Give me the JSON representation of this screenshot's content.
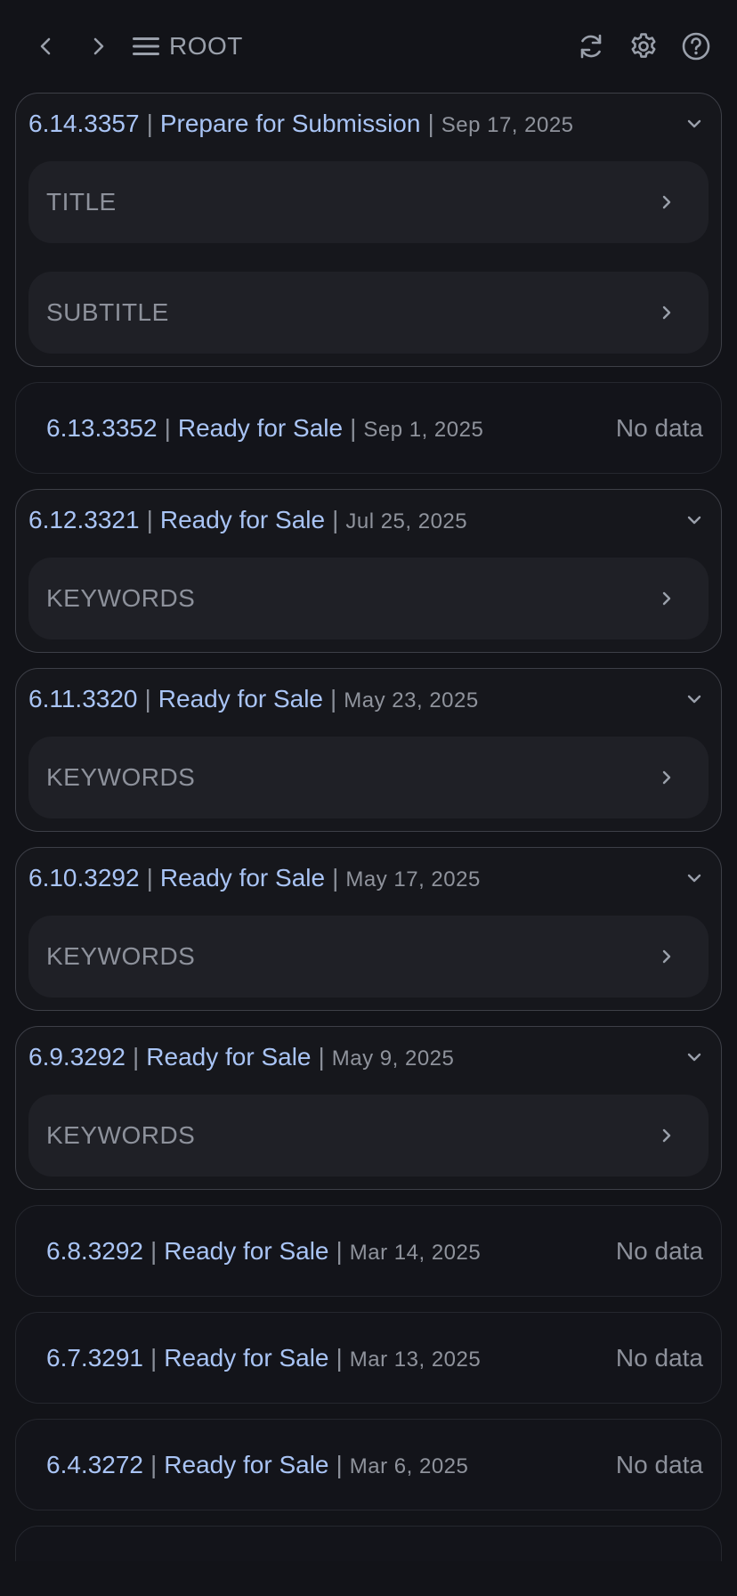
{
  "topbar": {
    "root_label": "ROOT",
    "icons": [
      "chevron-left-icon",
      "chevron-right-icon",
      "menu-icon",
      "refresh-icon",
      "gear-icon",
      "help-icon"
    ]
  },
  "colors": {
    "background": "#121318",
    "accent_text": "#a9c4f5",
    "muted_text": "#8d919b",
    "card_border": "#3d3f47",
    "field_bg": "#1f2026"
  },
  "separator": "|",
  "versions": [
    {
      "version": "6.14.3357",
      "status": "Prepare for Submission",
      "date": "Sep 17, 2025",
      "expanded": true,
      "fields": [
        "TITLE",
        "SUBTITLE"
      ]
    },
    {
      "version": "6.13.3352",
      "status": "Ready for Sale",
      "date": "Sep 1, 2025",
      "expanded": false,
      "no_data": "No data"
    },
    {
      "version": "6.12.3321",
      "status": "Ready for Sale",
      "date": "Jul 25, 2025",
      "expanded": true,
      "fields": [
        "KEYWORDS"
      ]
    },
    {
      "version": "6.11.3320",
      "status": "Ready for Sale",
      "date": "May 23, 2025",
      "expanded": true,
      "fields": [
        "KEYWORDS"
      ]
    },
    {
      "version": "6.10.3292",
      "status": "Ready for Sale",
      "date": "May 17, 2025",
      "expanded": true,
      "fields": [
        "KEYWORDS"
      ]
    },
    {
      "version": "6.9.3292",
      "status": "Ready for Sale",
      "date": "May 9, 2025",
      "expanded": true,
      "fields": [
        "KEYWORDS"
      ]
    },
    {
      "version": "6.8.3292",
      "status": "Ready for Sale",
      "date": "Mar 14, 2025",
      "expanded": false,
      "no_data": "No data"
    },
    {
      "version": "6.7.3291",
      "status": "Ready for Sale",
      "date": "Mar 13, 2025",
      "expanded": false,
      "no_data": "No data"
    },
    {
      "version": "6.4.3272",
      "status": "Ready for Sale",
      "date": "Mar 6, 2025",
      "expanded": false,
      "no_data": "No data"
    }
  ]
}
